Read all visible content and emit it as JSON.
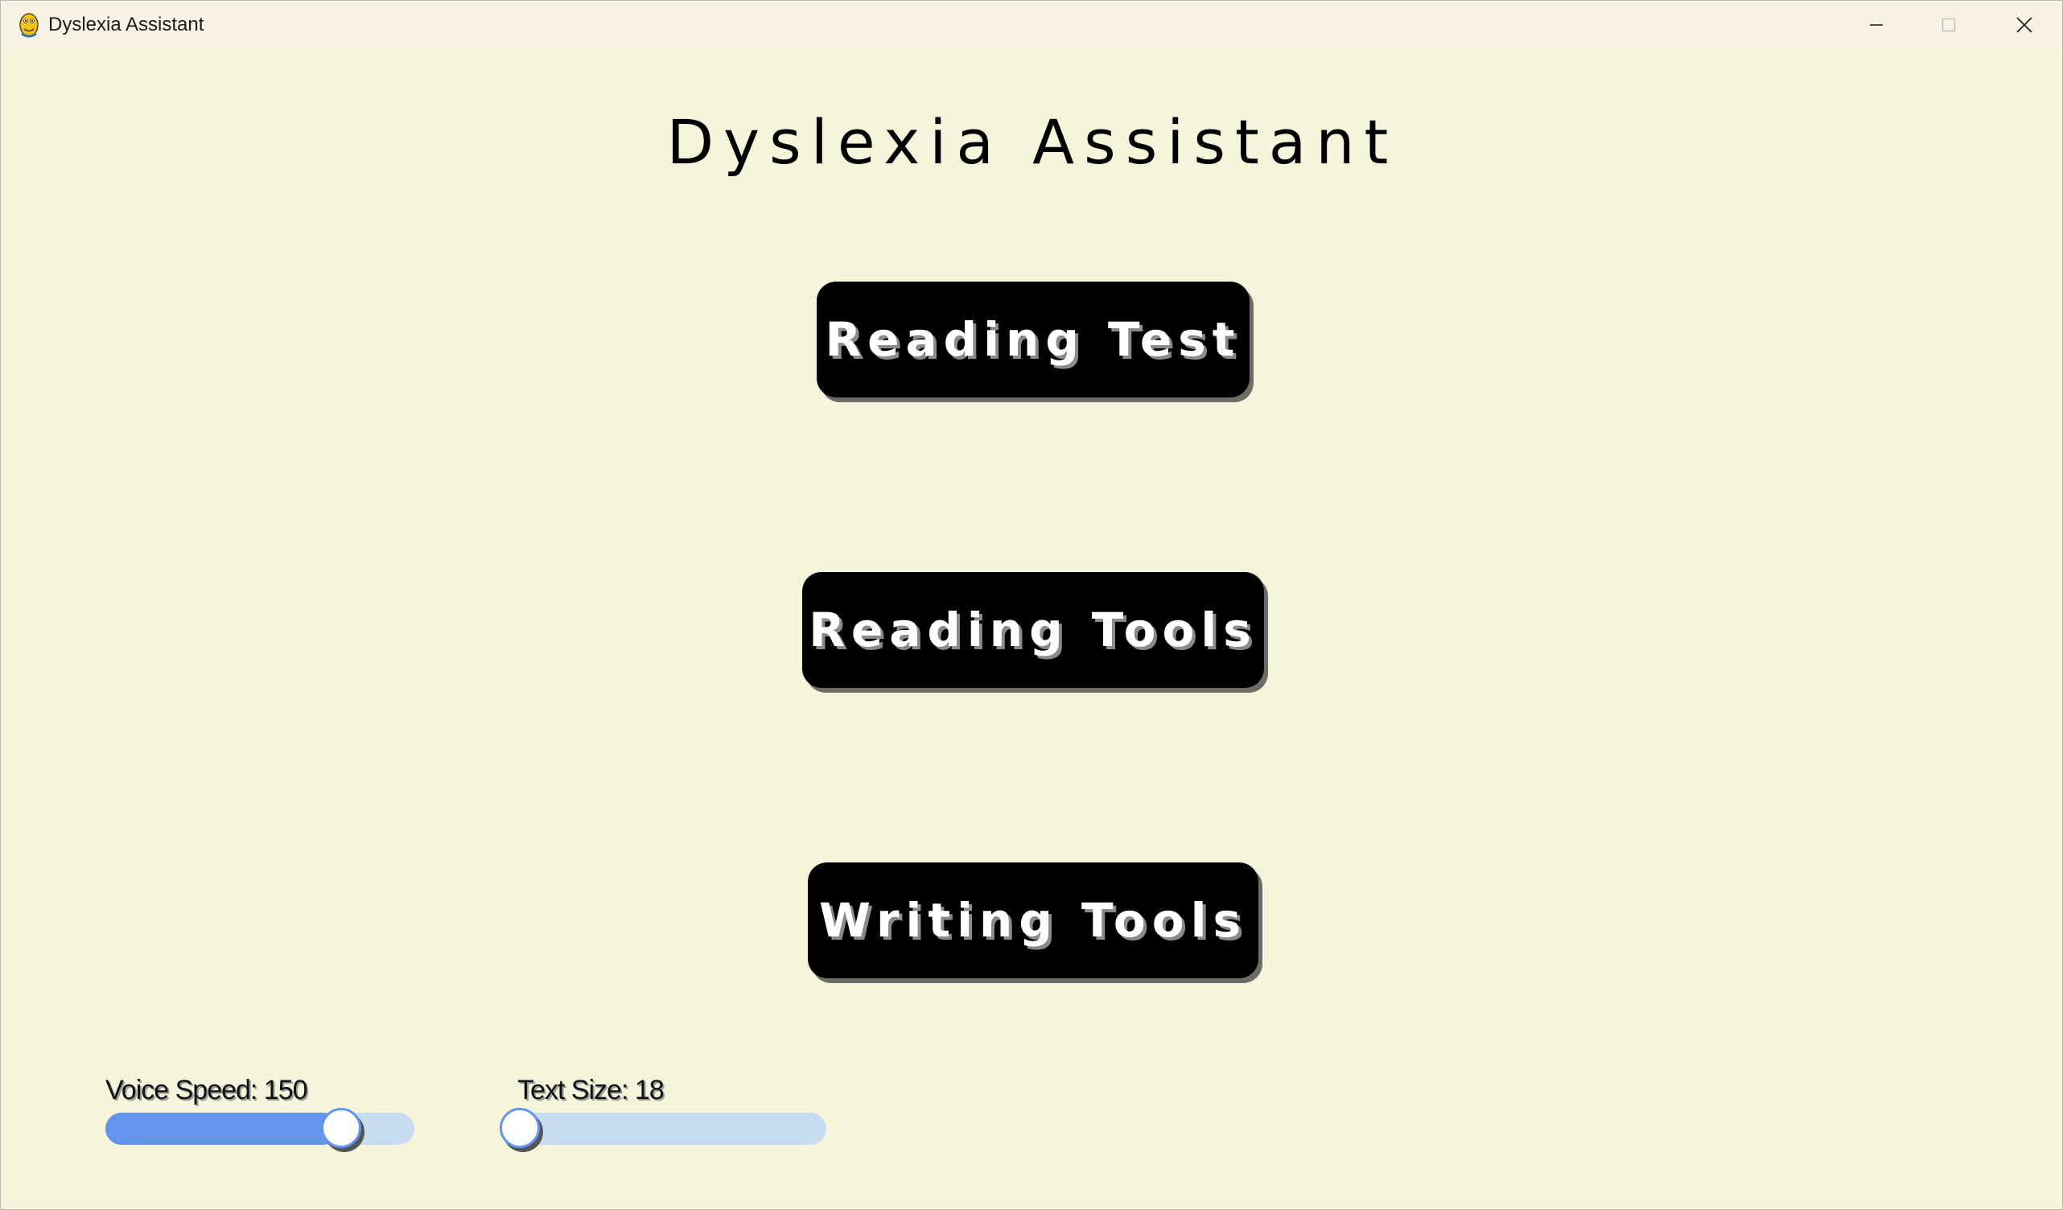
{
  "window": {
    "title": "Dyslexia Assistant",
    "icon": "python-snake-icon",
    "controls": [
      "minimize-icon",
      "maximize-icon",
      "close-icon"
    ]
  },
  "main": {
    "title": "Dyslexia Assistant",
    "buttons": [
      {
        "label": "Reading Test"
      },
      {
        "label": "Reading Tools"
      },
      {
        "label": "Writing Tools"
      }
    ]
  },
  "settings": {
    "voice_speed": {
      "label": "Voice Speed: 150",
      "value": 150,
      "fill_fraction": 0.74
    },
    "text_size": {
      "label": "Text Size: 18",
      "value": 18,
      "fill_fraction": 0.0
    }
  },
  "colors": {
    "background": "#f5f5dc",
    "titlebar": "#f8f2e6",
    "button": "#000000",
    "button_text": "#ffffff",
    "slider_fill": "#6495ed",
    "slider_track": "#c8dcef"
  }
}
